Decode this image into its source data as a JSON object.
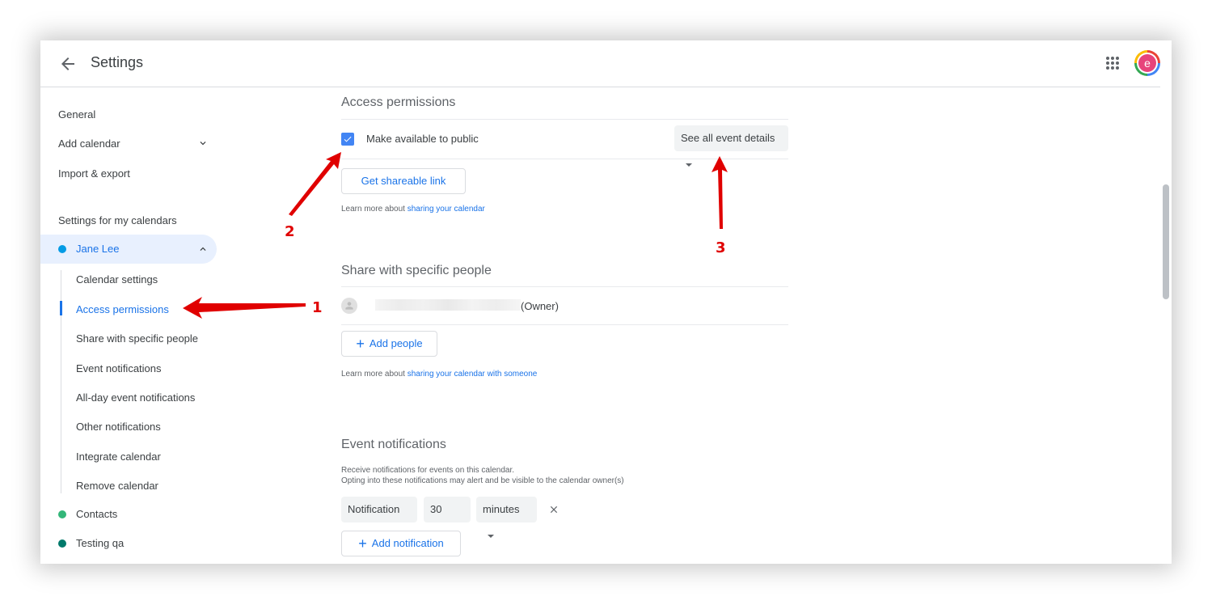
{
  "header": {
    "title": "Settings",
    "back_icon": "arrow-left-icon",
    "apps_icon": "apps-grid-icon",
    "avatar_letter": "e",
    "avatar_color": "#e7437b"
  },
  "sidebar": {
    "items": [
      {
        "label": "General"
      },
      {
        "label": "Add calendar"
      },
      {
        "label": "Import & export"
      }
    ],
    "section_title": "Settings for my calendars",
    "calendars": [
      {
        "label": "Jane Lee",
        "color": "#039be5",
        "expanded": true
      },
      {
        "label": "Contacts",
        "color": "#33b679"
      },
      {
        "label": "Testing qa",
        "color": "#009688"
      }
    ],
    "sub_items": [
      {
        "label": "Calendar settings"
      },
      {
        "label": "Access permissions",
        "active": true
      },
      {
        "label": "Share with specific people"
      },
      {
        "label": "Event notifications"
      },
      {
        "label": "All-day event notifications"
      },
      {
        "label": "Other notifications"
      },
      {
        "label": "Integrate calendar"
      },
      {
        "label": "Remove calendar"
      }
    ]
  },
  "access": {
    "title": "Access permissions",
    "public_label": "Make available to public",
    "public_checked": true,
    "visibility_select": "See all event details",
    "shareable_button": "Get shareable link",
    "learn_prefix": "Learn more about ",
    "learn_link": "sharing your calendar"
  },
  "share": {
    "title": "Share with specific people",
    "owner_suffix": "(Owner)",
    "add_button": "Add people",
    "learn_prefix": "Learn more about ",
    "learn_link": "sharing your calendar with someone"
  },
  "notifications": {
    "title": "Event notifications",
    "desc1": "Receive notifications for events on this calendar.",
    "desc2": "Opting into these notifications may alert and be visible to the calendar owner(s)",
    "type_select": "Notification",
    "amount": "30",
    "unit_select": "minutes",
    "add_button": "Add notification"
  },
  "annotations": [
    "1",
    "2",
    "3"
  ],
  "colors": {
    "accent": "#1a73e8",
    "arrow": "#e00000"
  }
}
